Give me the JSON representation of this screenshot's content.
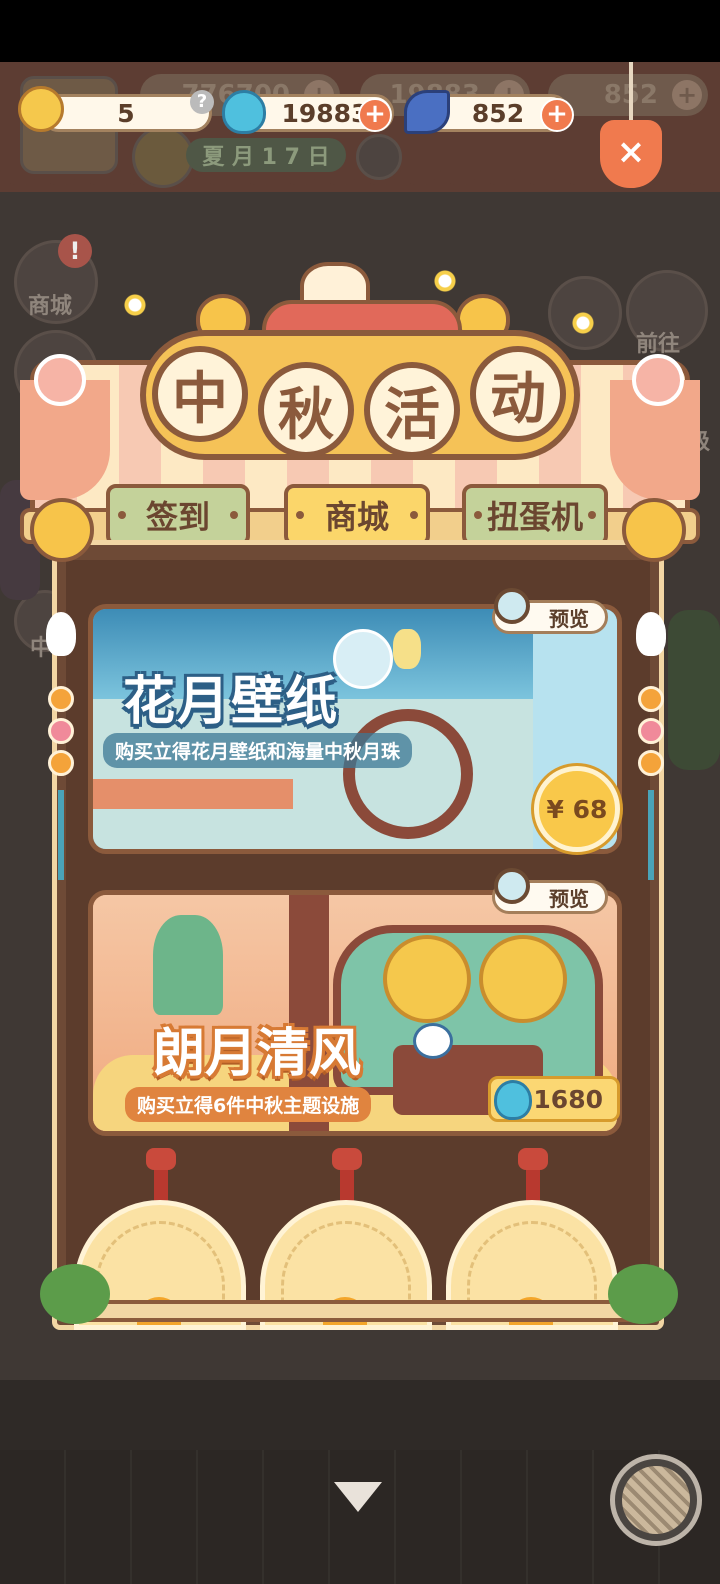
{
  "background_hud": {
    "coins_value": "776700",
    "gems_value": "19883",
    "feathers_value": "852",
    "date_text": "夏 月 1 7 日",
    "left_menu_shop": "商城",
    "right_menu_go": "前往",
    "right_menu_level": "级",
    "left_menu_mid": "中"
  },
  "currency_bar": {
    "tickets": "5",
    "tickets_help": "?",
    "gems": "19883",
    "feathers": "852",
    "plus": "+"
  },
  "close_button": {
    "label": "×"
  },
  "banner": {
    "title_chars": [
      "中",
      "秋",
      "活",
      "动"
    ]
  },
  "tabs": [
    {
      "label": "签到",
      "active": false
    },
    {
      "label": "商城",
      "active": true
    },
    {
      "label": "扭蛋机",
      "active": false
    }
  ],
  "products": [
    {
      "title": "花月壁纸",
      "subtitle": "购买立得花月壁纸和海量中秋月珠",
      "preview": "预览",
      "price": "¥ 68"
    },
    {
      "title": "朗月清风",
      "subtitle": "购买立得6件中秋主题设施",
      "preview": "预览",
      "price": "1680"
    }
  ],
  "colors": {
    "accent_orange": "#f07a4e",
    "frame_brown": "#8b5a3c",
    "tab_active": "#fbd66a",
    "tab_inactive": "#c4d29a"
  }
}
